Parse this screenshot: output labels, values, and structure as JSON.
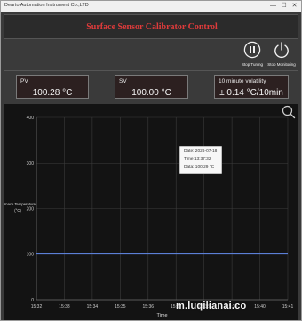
{
  "window": {
    "title": "Dearto Automation Instrument Co.,LTD",
    "controls": {
      "minimize": "—",
      "maximize": "☐",
      "close": "✕"
    }
  },
  "header": {
    "title": "Surface Sensor Calibrator Control"
  },
  "controls": {
    "stop_tuning_label": "Stop Tuning",
    "stop_monitoring_label": "Stop Monitoring"
  },
  "readouts": {
    "pv": {
      "label": "PV",
      "value": "100.28 °C"
    },
    "sv": {
      "label": "SV",
      "value": "100.00 °C"
    },
    "volatility": {
      "label": "10 minute volatility",
      "value": "± 0.14 °C/10min"
    }
  },
  "tooltip": {
    "date": "Date: 2026-07-18",
    "time": "Time:13:37:32",
    "data": "Data: 100.29 °C"
  },
  "watermark": "m.luqilianai.co",
  "colors": {
    "title_red": "#e03b3b",
    "series_line": "#5b7fd6",
    "grid": "#3c3c3c",
    "plot_bg": "#131313"
  },
  "chart_data": {
    "type": "line",
    "xlabel": "Time",
    "ylabel_lines": [
      "Furnace Temperature",
      "(°C)"
    ],
    "ylim": [
      0,
      400
    ],
    "yticks": [
      0,
      100,
      200,
      300,
      400
    ],
    "grid": true,
    "categories": [
      "15:32",
      "15:33",
      "15:34",
      "15:35",
      "15:36",
      "15:37",
      "15:38",
      "15:39",
      "15:40",
      "15:41"
    ],
    "series": [
      {
        "values": [
          100.3,
          100.3,
          100.3,
          100.3,
          100.3,
          100.3,
          100.3,
          100.3,
          100.3,
          100.3
        ]
      }
    ]
  }
}
